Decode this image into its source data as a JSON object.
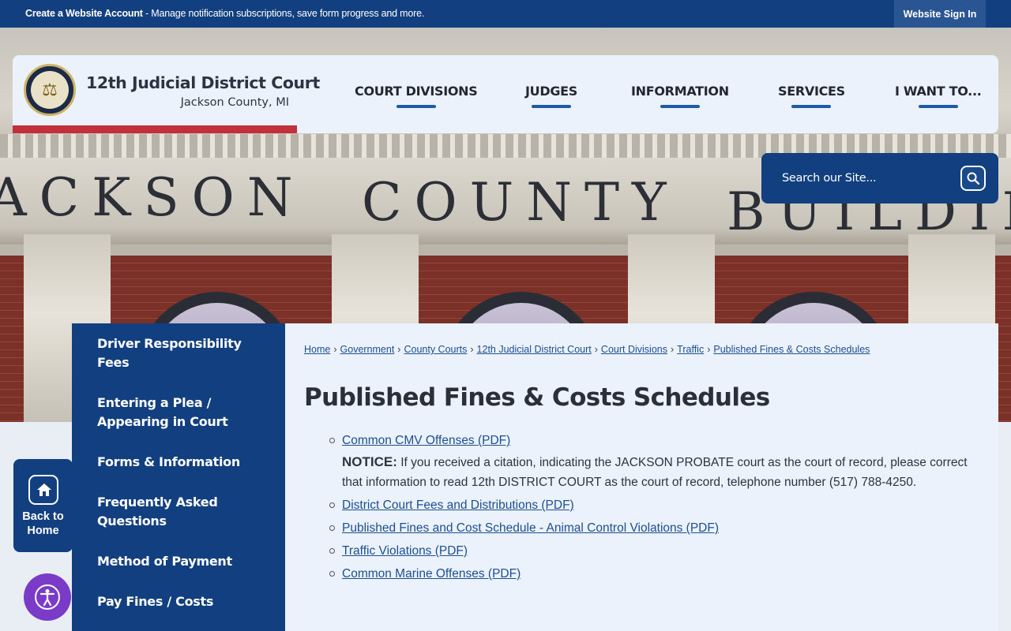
{
  "topbar": {
    "create_link": "Create a Website Account",
    "create_desc": " - Manage notification subscriptions, save form progress and more.",
    "signin": "Website Sign In"
  },
  "hero": {
    "frieze_words": [
      "ACKSON",
      "COUNTY",
      "BUILDIN"
    ]
  },
  "brand": {
    "title": "12th Judicial District Court",
    "subtitle": "Jackson County, MI"
  },
  "nav": [
    "COURT DIVISIONS",
    "JUDGES",
    "INFORMATION",
    "SERVICES",
    "I WANT TO..."
  ],
  "search": {
    "placeholder": "Search our Site..."
  },
  "sidenav": [
    "Driver Responsibility Fees",
    "Entering a Plea / Appearing in Court",
    "Forms & Information",
    "Frequently Asked Questions",
    "Method of Payment",
    "Pay Fines / Costs"
  ],
  "breadcrumb": [
    "Home",
    "Government",
    "County Courts",
    "12th Judicial District Court",
    "Court Divisions",
    "Traffic",
    "Published Fines & Costs Schedules"
  ],
  "page_title": "Published Fines & Costs Schedules",
  "documents": {
    "first": "Common CMV Offenses (PDF)",
    "notice_label": "NOTICE:",
    "notice_text": " If you received a citation, indicating the JACKSON PROBATE court as the court of record, please correct that information to read 12th DISTRICT COURT as the court of record, telephone number (517) 788-4250.",
    "rest": [
      "District Court Fees and Distributions (PDF)",
      "Published Fines and Cost Schedule - Animal Control Violations (PDF)",
      "Traffic Violations (PDF)",
      "Common Marine Offenses (PDF)"
    ]
  },
  "back_home": "Back to Home",
  "colors": {
    "primary": "#123f80",
    "accent_red": "#c1303b",
    "link": "#1b4f93",
    "a11y": "#7a3cc8"
  },
  "icons": {
    "search": "search-icon",
    "home": "home-icon",
    "a11y": "accessibility-icon"
  }
}
